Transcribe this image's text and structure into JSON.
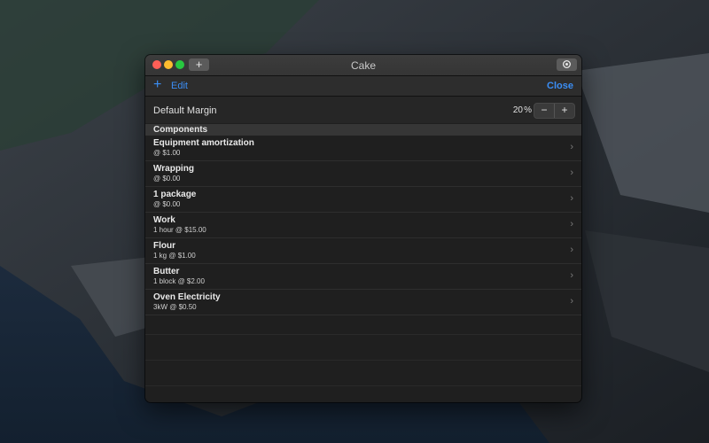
{
  "window": {
    "title": "Cake",
    "titlebar_add": "+",
    "gear_icon": "gear-icon"
  },
  "toolbar": {
    "add_icon": "+",
    "edit_label": "Edit",
    "close_label": "Close"
  },
  "margin": {
    "label": "Default Margin",
    "value": "20",
    "unit": "%",
    "minus": "−",
    "plus": "+"
  },
  "components": {
    "header": "Components",
    "items": [
      {
        "title": "Equipment amortization",
        "detail": " @ $1.00"
      },
      {
        "title": "Wrapping",
        "detail": " @ $0.00"
      },
      {
        "title": "1 package",
        "detail": " @ $0.00"
      },
      {
        "title": "Work",
        "detail": "1 hour @ $15.00"
      },
      {
        "title": "Flour",
        "detail": "1 kg @ $1.00"
      },
      {
        "title": "Butter",
        "detail": "1 block @ $2.00"
      },
      {
        "title": "Oven Electricity",
        "detail": "3kW @ $0.50"
      }
    ],
    "chevron": "›"
  },
  "colors": {
    "accent": "#3b8ef5",
    "window_bg": "#1f1f1f"
  }
}
